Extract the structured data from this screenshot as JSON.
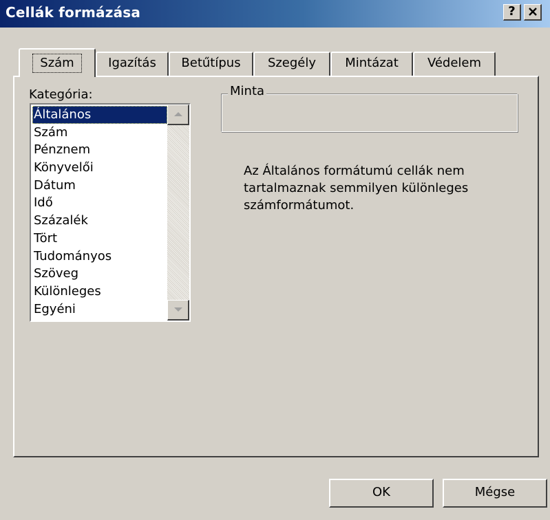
{
  "window": {
    "title": "Cellák formázása",
    "help_label": "?",
    "close_label": "✕"
  },
  "tabs": [
    {
      "label": "Szám",
      "active": true
    },
    {
      "label": "Igazítás"
    },
    {
      "label": "Betűtípus"
    },
    {
      "label": "Szegély"
    },
    {
      "label": "Mintázat"
    },
    {
      "label": "Védelem"
    }
  ],
  "category": {
    "label": "Kategória:",
    "items": [
      "Általános",
      "Szám",
      "Pénznem",
      "Könyvelői",
      "Dátum",
      "Idő",
      "Százalék",
      "Tört",
      "Tudományos",
      "Szöveg",
      "Különleges",
      "Egyéni"
    ],
    "selected": "Általános"
  },
  "sample": {
    "title": "Minta",
    "value": ""
  },
  "description": "Az Általános formátumú cellák nem tartalmaznak semmilyen különleges számformátumot.",
  "buttons": {
    "ok": "OK",
    "cancel": "Mégse"
  },
  "icons": {
    "scroll_up": "scroll-up-arrow-icon",
    "scroll_down": "scroll-down-arrow-icon"
  }
}
